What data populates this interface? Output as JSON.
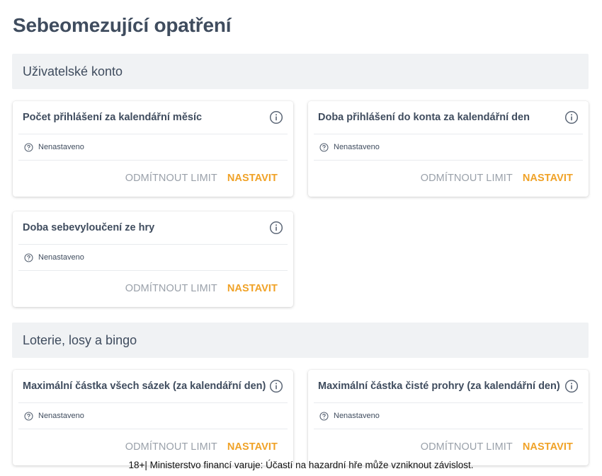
{
  "page_title": "Sebeomezující opatření",
  "sections": [
    {
      "title": "Uživatelské konto",
      "cards": [
        {
          "title": "Počet přihlášení za kalendářní měsíc",
          "status": "Nenastaveno",
          "decline_label": "Odmítnout limit",
          "set_label": "Nastavit"
        },
        {
          "title": "Doba přihlášení do konta za kalendářní den",
          "status": "Nenastaveno",
          "decline_label": "Odmítnout limit",
          "set_label": "Nastavit"
        },
        {
          "title": "Doba sebevyloučení ze hry",
          "status": "Nenastaveno",
          "decline_label": "Odmítnout limit",
          "set_label": "Nastavit"
        }
      ]
    },
    {
      "title": "Loterie, losy a bingo",
      "cards": [
        {
          "title": "Maximální částka všech sázek (za kalendářní den)",
          "status": "Nenastaveno",
          "decline_label": "Odmítnout limit",
          "set_label": "Nastavit"
        },
        {
          "title": "Maximální částka čisté prohry (za kalendářní den)",
          "status": "Nenastaveno",
          "decline_label": "Odmítnout limit",
          "set_label": "Nastavit"
        }
      ]
    }
  ],
  "footer_note": "18+| Ministerstvo financí varuje: Účastí na hazardní hře může vzniknout závislost.",
  "icons": {
    "info": "info-circle-icon",
    "status": "question-circle-icon"
  },
  "colors": {
    "accent": "#f0a227",
    "muted": "#9aa1aa",
    "text": "#3f4c5e",
    "section_bg": "#f0f2f4"
  }
}
